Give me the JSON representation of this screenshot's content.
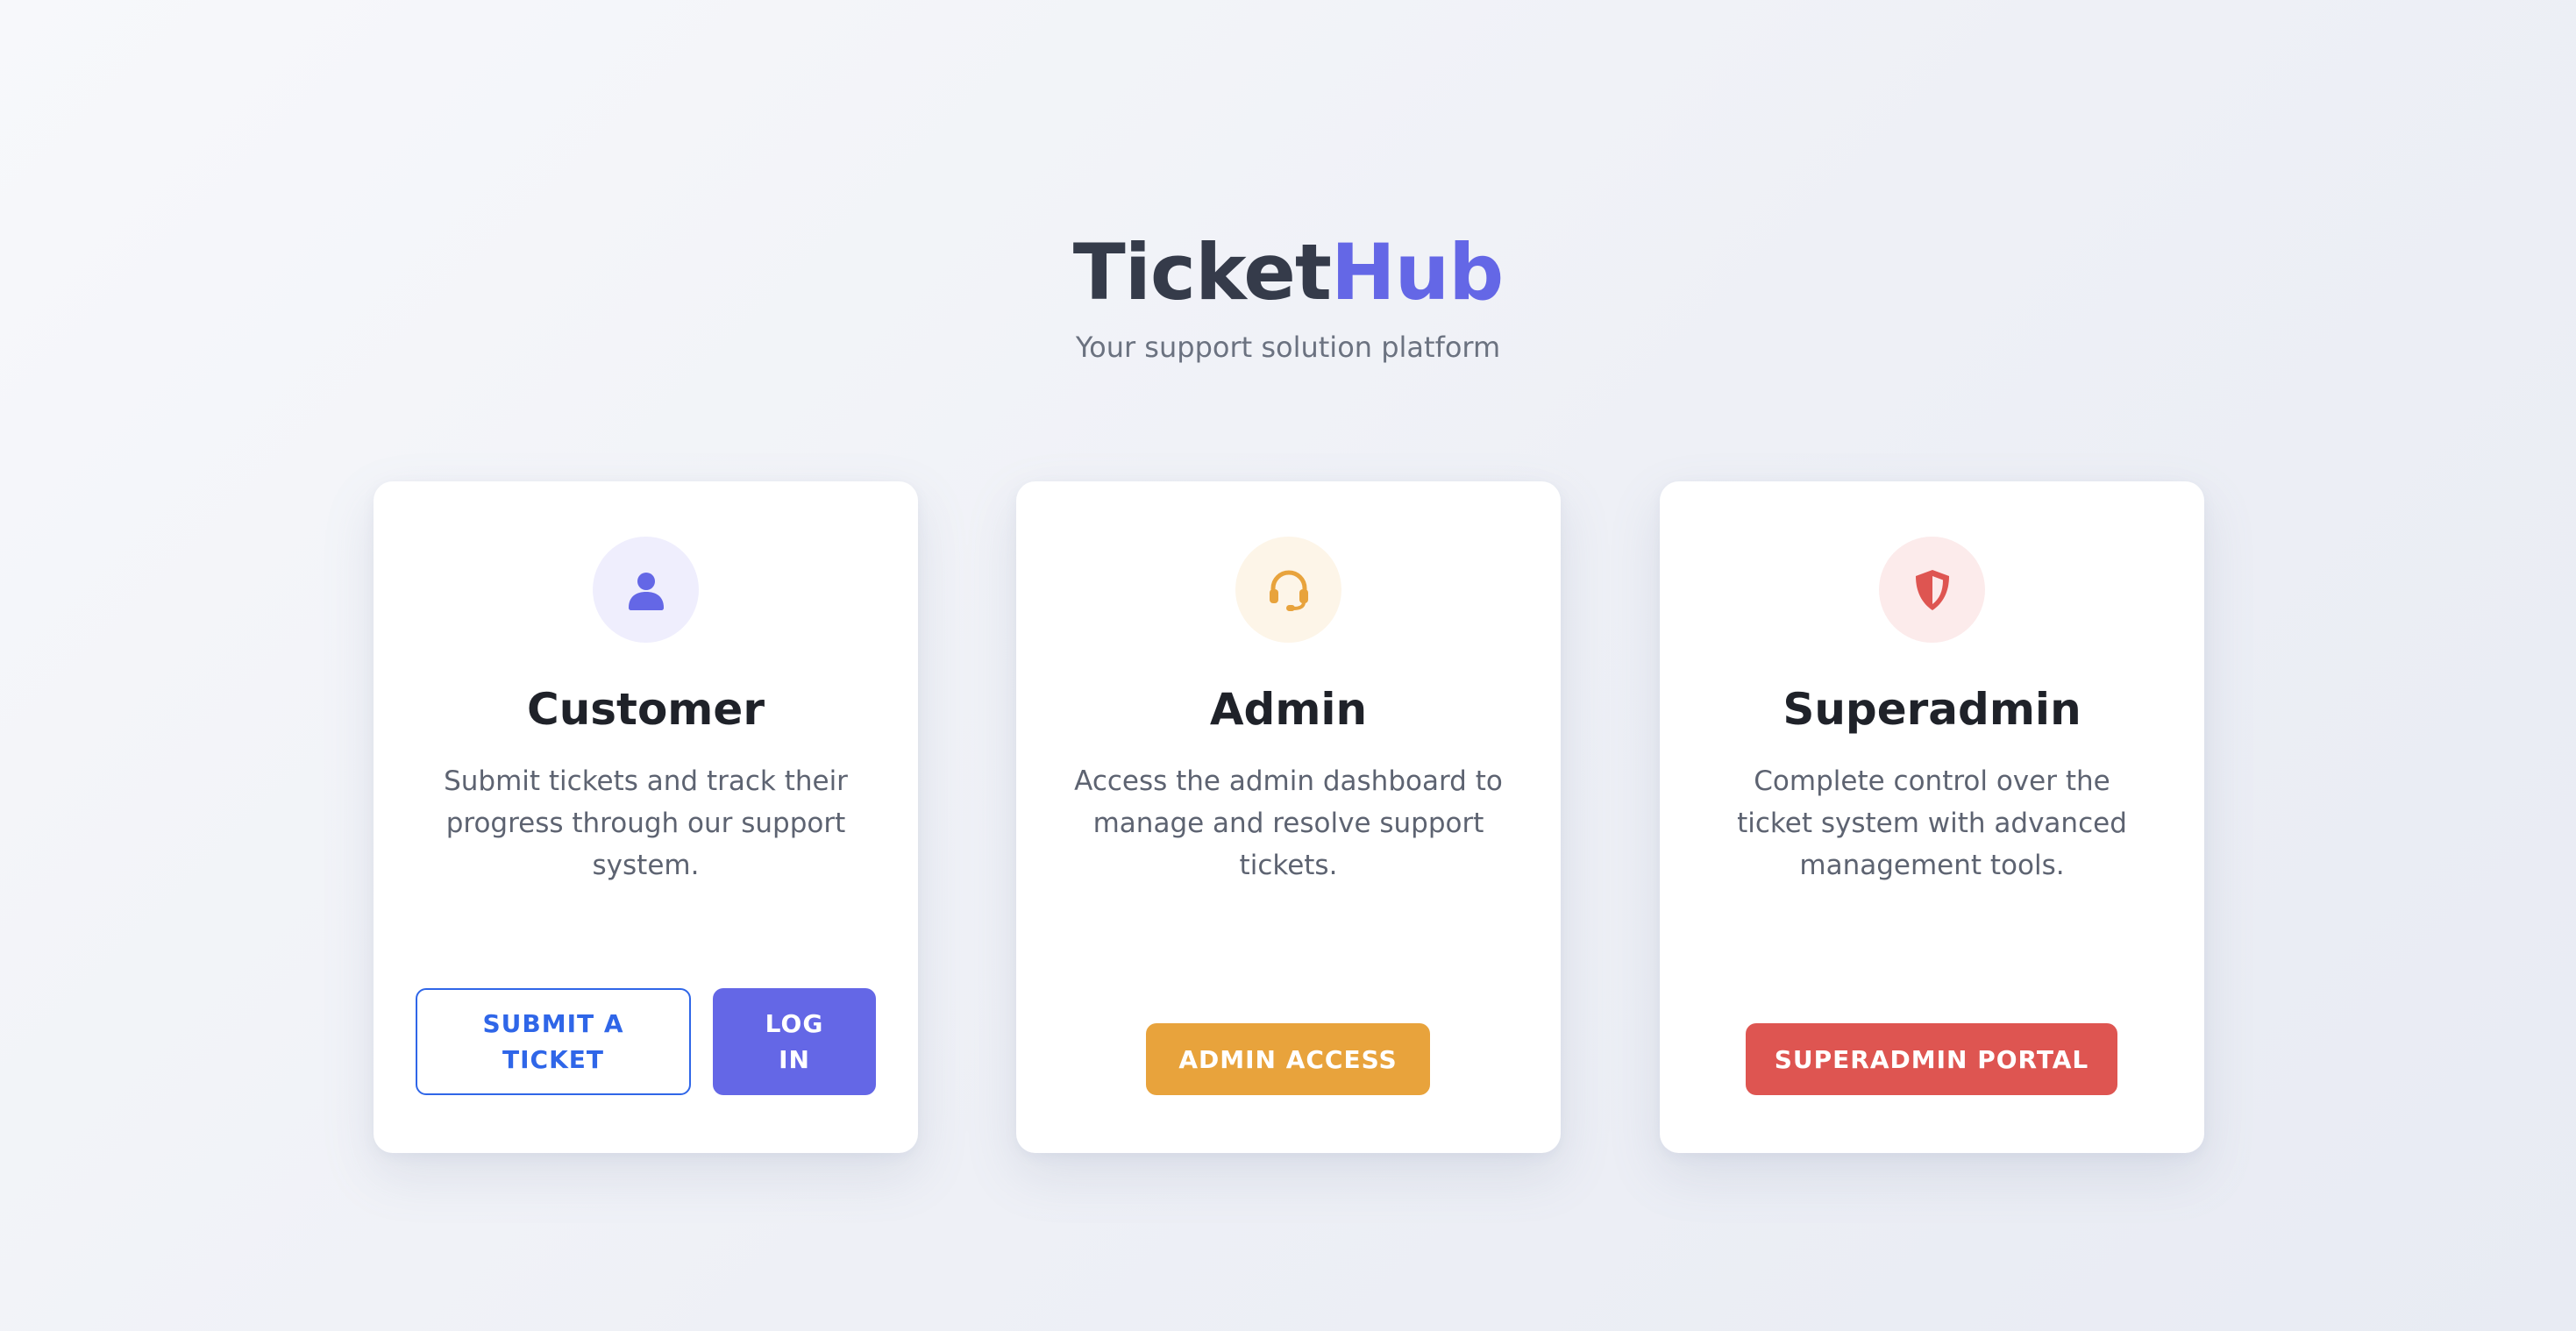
{
  "brand": {
    "part1": "Ticket",
    "part2": "Hub",
    "tagline": "Your support solution platform"
  },
  "colors": {
    "brand_dark": "#353b4a",
    "accent": "#6467e6",
    "customer_outline": "#2f66e8",
    "admin": "#e8a33c",
    "superadmin": "#de5551"
  },
  "cards": [
    {
      "icon": "user-icon",
      "title": "Customer",
      "description": "Submit tickets and track their progress through our support system.",
      "buttons": [
        "SUBMIT A TICKET",
        "LOG IN"
      ]
    },
    {
      "icon": "headset-icon",
      "title": "Admin",
      "description": "Access the admin dashboard to manage and resolve support tickets.",
      "buttons": [
        "ADMIN ACCESS"
      ]
    },
    {
      "icon": "shield-icon",
      "title": "Superadmin",
      "description": "Complete control over the ticket system with advanced management tools.",
      "buttons": [
        "SUPERADMIN PORTAL"
      ]
    }
  ]
}
